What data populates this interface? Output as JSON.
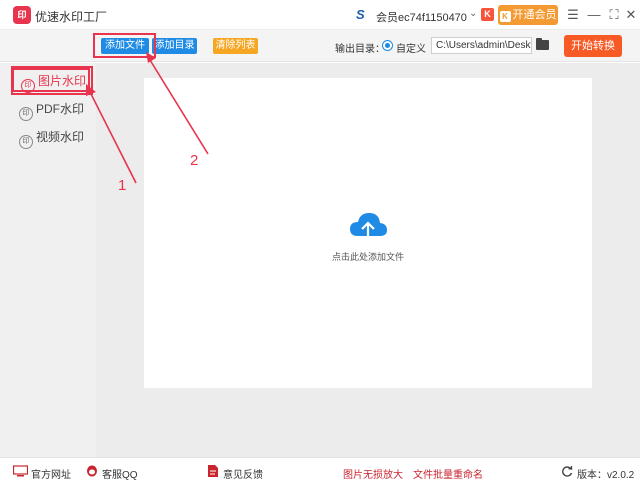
{
  "app": {
    "title": "优速水印工厂",
    "logo_text": "印"
  },
  "account": {
    "name": "会员ec74f1150470",
    "badge": "K",
    "vip_button": "开通会员"
  },
  "window_controls": {
    "menu": "☰",
    "minimize": "—",
    "maximize": "⛶",
    "close": "✕"
  },
  "toolbar": {
    "add_file": "添加文件",
    "add_folder": "添加目录",
    "clear_list": "清除列表",
    "output_label": "输出目录：",
    "radio_label": "自定义",
    "output_path": "C:\\Users\\admin\\Deskto",
    "start_button": "开始转换"
  },
  "sidebar": {
    "items": [
      {
        "label": "图片水印",
        "icon": "印",
        "active": true
      },
      {
        "label": "PDF水印",
        "icon": "印",
        "active": false
      },
      {
        "label": "视频水印",
        "icon": "印",
        "active": false
      }
    ]
  },
  "main": {
    "drop_hint": "点击此处添加文件"
  },
  "statusbar": {
    "website": "官方网址",
    "qq": "客服QQ",
    "feedback": "意见反馈",
    "image_enlarge": "图片无损放大",
    "batch_rename": "文件批量重命名",
    "version_label": "版本：v2.0.2"
  },
  "annotations": {
    "step1": "1",
    "step2": "2"
  },
  "colors": {
    "accent_red": "#e8344e",
    "blue": "#1f8be4",
    "orange": "#f5a623",
    "start": "#f75a24"
  }
}
